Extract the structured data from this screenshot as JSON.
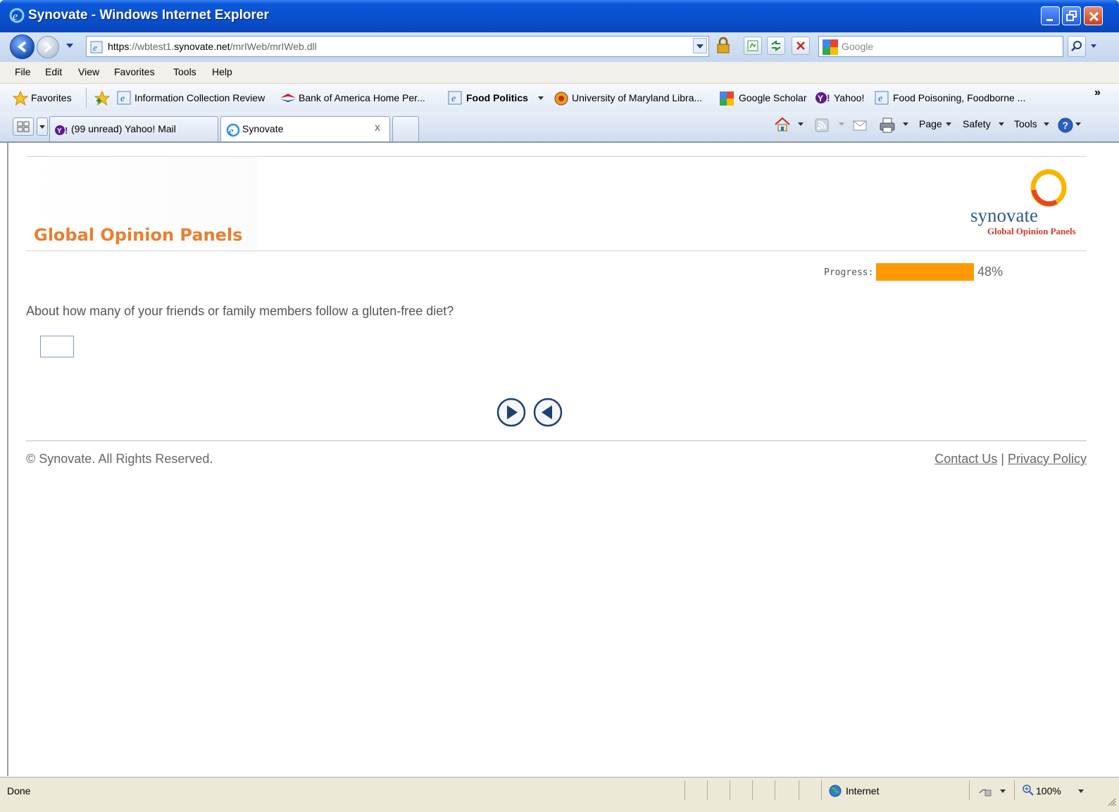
{
  "window": {
    "title": "Synovate - Windows Internet Explorer"
  },
  "address_bar": {
    "url_scheme": "https",
    "url_sep": "://",
    "url_sub": "wbtest1.",
    "url_domain": "synovate.net",
    "url_path": "/mrIWeb/mrIWeb.dll",
    "search_placeholder": "Google"
  },
  "menu": {
    "items": [
      "File",
      "Edit",
      "View",
      "Favorites",
      "Tools",
      "Help"
    ]
  },
  "favorites_bar": {
    "label": "Favorites",
    "links": [
      "Information Collection Review",
      "Bank of America  Home  Per...",
      "Food Politics",
      "University of Maryland Libra...",
      "Google Scholar",
      "Yahoo!",
      "Food Poisoning, Foodborne ..."
    ],
    "overflow": "»"
  },
  "tabs": {
    "items": [
      "(99 unread) Yahoo! Mail",
      "Synovate"
    ],
    "close": "x"
  },
  "command_bar": {
    "page": "Page",
    "safety": "Safety",
    "tools": "Tools"
  },
  "survey": {
    "brand": "Global Opinion Panels",
    "logo_word": "synovate",
    "logo_sub": "Global Opinion Panels",
    "progress_label": "Progress:",
    "progress_value": 48,
    "progress_text": "48%",
    "question": "About how many of your friends or family members follow a gluten-free diet?",
    "answer_value": "",
    "footer_copyright": "© Synovate. All Rights Reserved.",
    "footer_contact": "Contact Us",
    "footer_separator": "|",
    "footer_privacy": "Privacy Policy"
  },
  "status_bar": {
    "status": "Done",
    "zone": "Internet",
    "zoom": "100%"
  },
  "colors": {
    "brand_orange": "#e87f2e",
    "progress_orange": "#ff9900",
    "titlebar_blue": "#0a4fcc"
  }
}
